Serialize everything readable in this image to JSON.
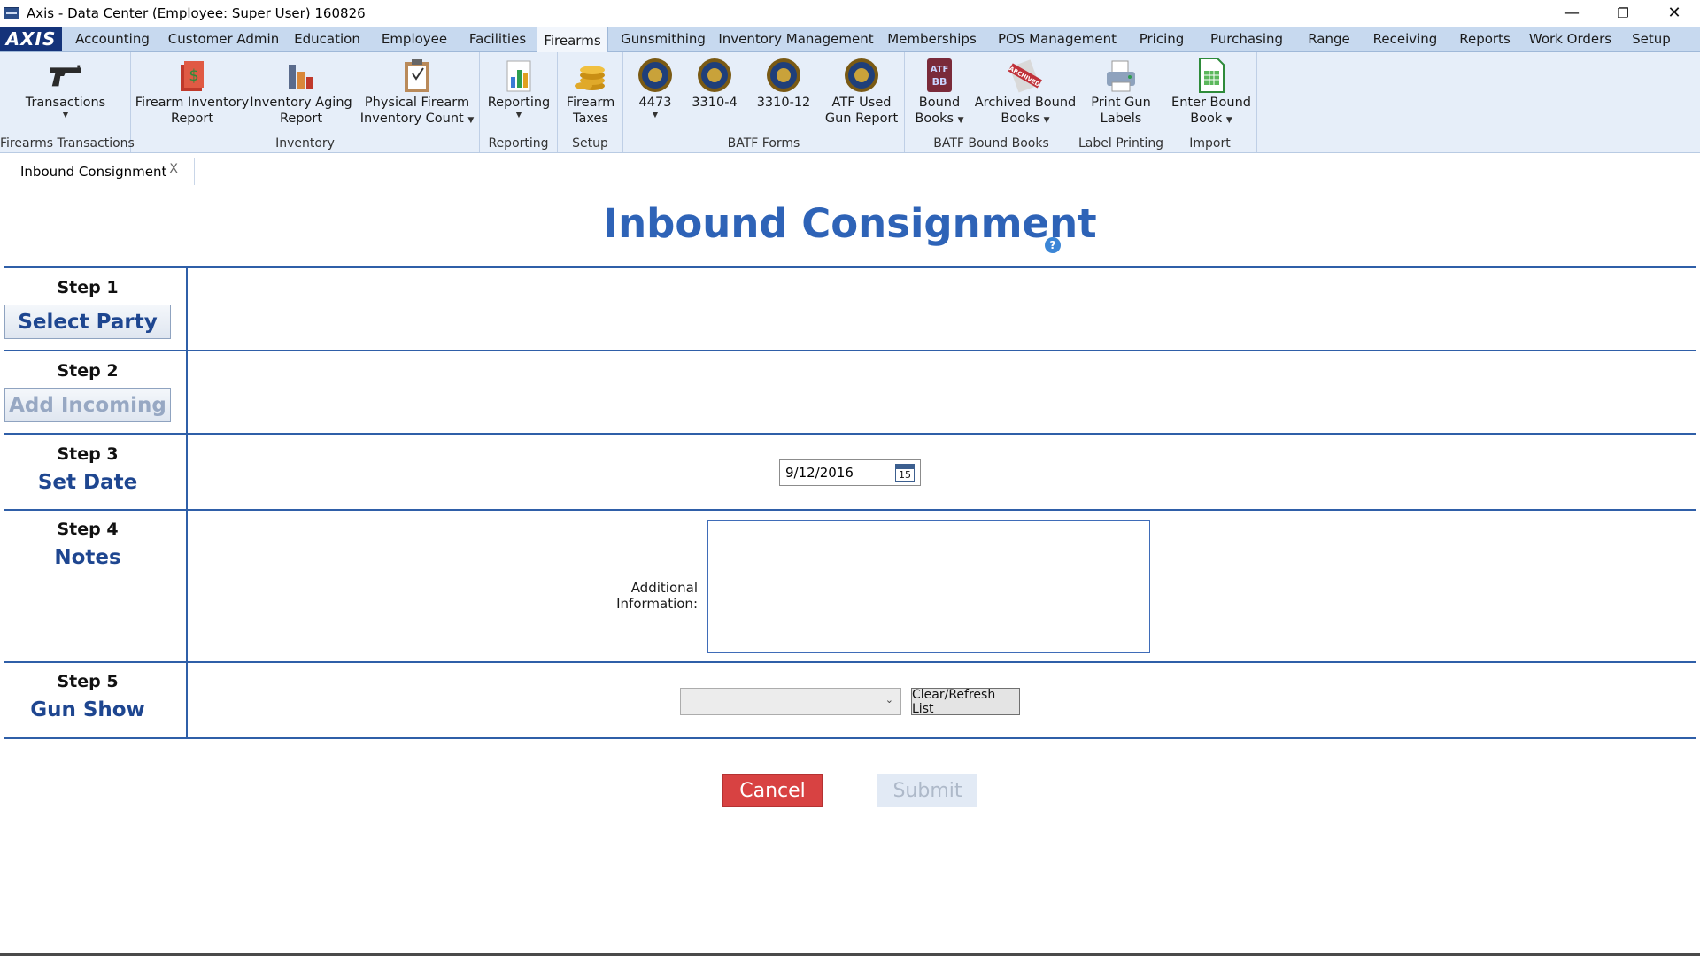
{
  "window": {
    "title": "Axis - Data Center  (Employee: Super User) 160826",
    "minimize": "—",
    "restore": "❐",
    "close": "✕"
  },
  "logo": "AXIS",
  "menu": [
    "Accounting",
    "Customer Admin",
    "Education",
    "Employee",
    "Facilities",
    "Firearms",
    "Gunsmithing",
    "Inventory Management",
    "Memberships",
    "POS Management",
    "Pricing",
    "Purchasing",
    "Range",
    "Receiving",
    "Reports",
    "Work Orders",
    "Setup"
  ],
  "ribbon": {
    "groups": {
      "firearms_transactions": "Firearms Transactions",
      "inventory": "Inventory",
      "reporting": "Reporting",
      "setup": "Setup",
      "batf_forms": "BATF Forms",
      "batf_bound_books": "BATF Bound Books",
      "label_printing": "Label Printing",
      "import": "Import"
    },
    "buttons": {
      "transactions": [
        "Transactions",
        ""
      ],
      "firearm_inventory_report": [
        "Firearm Inventory",
        "Report"
      ],
      "inventory_aging_report": [
        "Inventory Aging",
        "Report"
      ],
      "physical_firearm_inventory_count": [
        "Physical Firearm",
        "Inventory Count"
      ],
      "reporting": [
        "Reporting",
        ""
      ],
      "firearm_taxes": [
        "Firearm",
        "Taxes"
      ],
      "f4473": [
        "4473",
        ""
      ],
      "f3310_4": [
        "3310-4",
        ""
      ],
      "f3310_12": [
        "3310-12",
        ""
      ],
      "atf_used_gun_report": [
        "ATF Used",
        "Gun Report"
      ],
      "bound_books": [
        "Bound",
        "Books"
      ],
      "archived_bound_books": [
        "Archived Bound",
        "Books"
      ],
      "print_gun_labels": [
        "Print Gun",
        "Labels"
      ],
      "enter_bound_book": [
        "Enter Bound",
        "Book"
      ]
    },
    "icons": {
      "atf": "ATF",
      "bb": "BB",
      "archived": "ARCHIVED"
    }
  },
  "doc_tab": {
    "label": "Inbound Consignment",
    "close": "X"
  },
  "page": {
    "title": "Inbound Consignment",
    "help": "?",
    "steps": [
      {
        "num": "Step 1",
        "label": "Select Party"
      },
      {
        "num": "Step 2",
        "label": "Add Incoming"
      },
      {
        "num": "Step 3",
        "label": "Set Date"
      },
      {
        "num": "Step 4",
        "label": "Notes"
      },
      {
        "num": "Step 5",
        "label": "Gun Show"
      }
    ],
    "date_value": "9/12/2016",
    "calendar_day": "15",
    "notes_label": "Additional Information:",
    "notes_value": "",
    "gun_show_value": "",
    "refresh_label": "Clear/Refresh List",
    "cancel_label": "Cancel",
    "submit_label": "Submit"
  },
  "colors": {
    "accent": "#2e63b7",
    "divider": "#2f5fa8",
    "cancel": "#d84242",
    "menubar": "#c7d9ef",
    "ribbon": "#e6eef9"
  }
}
